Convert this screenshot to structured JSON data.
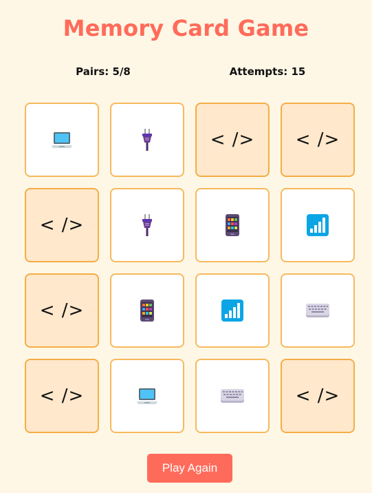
{
  "title": "Memory Card Game",
  "stats": {
    "pairs_text": "Pairs: 5/8",
    "attempts_text": "Attempts: 15"
  },
  "cards": [
    {
      "state": "revealed",
      "icon": "laptop-icon"
    },
    {
      "state": "revealed",
      "icon": "plug-icon"
    },
    {
      "state": "hidden",
      "back": "< />"
    },
    {
      "state": "hidden",
      "back": "< />"
    },
    {
      "state": "hidden",
      "back": "< />"
    },
    {
      "state": "revealed",
      "icon": "plug-icon"
    },
    {
      "state": "revealed",
      "icon": "mobile-phone-icon"
    },
    {
      "state": "revealed",
      "icon": "signal-bars-icon"
    },
    {
      "state": "hidden",
      "back": "< />"
    },
    {
      "state": "revealed",
      "icon": "mobile-phone-icon"
    },
    {
      "state": "revealed",
      "icon": "signal-bars-icon"
    },
    {
      "state": "revealed",
      "icon": "keyboard-icon"
    },
    {
      "state": "hidden",
      "back": "< />"
    },
    {
      "state": "revealed",
      "icon": "laptop-icon"
    },
    {
      "state": "revealed",
      "icon": "keyboard-icon"
    },
    {
      "state": "hidden",
      "back": "< />"
    }
  ],
  "play_again_label": "Play Again",
  "colors": {
    "background": "#fef7e6",
    "accent": "#ff6b5a",
    "card_border": "#f5b04a",
    "card_hidden_bg": "#ffe8cc",
    "card_revealed_bg": "#ffffff"
  }
}
